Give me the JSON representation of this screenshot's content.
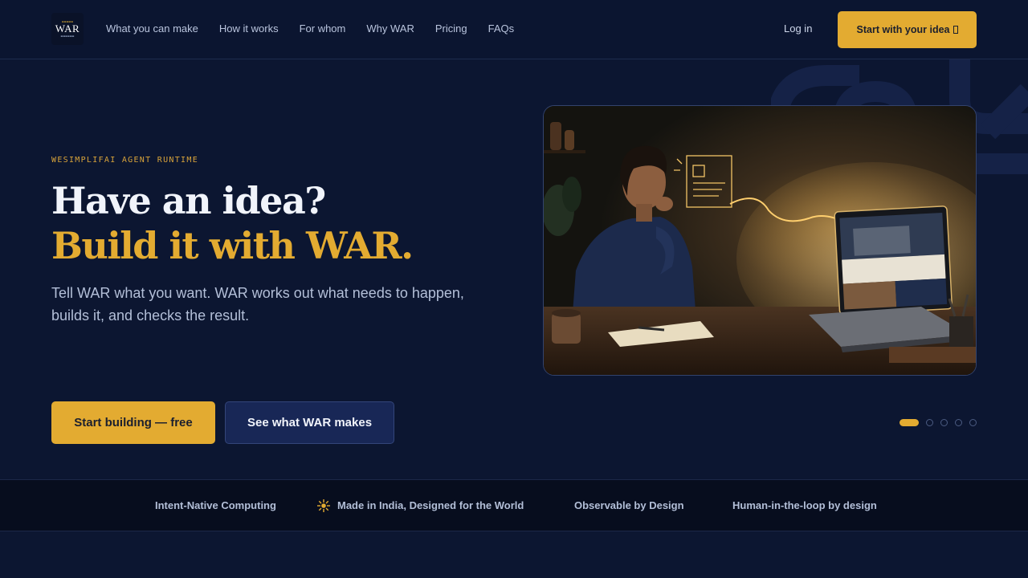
{
  "header": {
    "logo_alt": "WAR",
    "nav": [
      {
        "label": "What you can make"
      },
      {
        "label": "How it works"
      },
      {
        "label": "For whom"
      },
      {
        "label": "Why WAR"
      },
      {
        "label": "Pricing"
      },
      {
        "label": "FAQs"
      }
    ],
    "login_label": "Log in",
    "cta_label": "Start with your idea"
  },
  "hero": {
    "eyebrow": "WESIMPLIFAI AGENT RUNTIME",
    "title_line1": "Have an idea?",
    "title_line2": "Build it with WAR.",
    "subtitle": "Tell WAR what you want. WAR works out what needs to happen, builds it, and checks the result.",
    "primary_button": "Start building — free",
    "secondary_button": "See what WAR makes",
    "carousel": {
      "total": 5,
      "active_index": 0
    }
  },
  "features": [
    {
      "label": "Intent-Native Computing"
    },
    {
      "label": "Made in India, Designed for the World",
      "icon": "sun-icon"
    },
    {
      "label": "Observable by Design"
    },
    {
      "label": "Human-in-the-loop by design"
    }
  ],
  "colors": {
    "background": "#0c1631",
    "accent": "#e3ab31",
    "strip_background": "#070d1e"
  }
}
